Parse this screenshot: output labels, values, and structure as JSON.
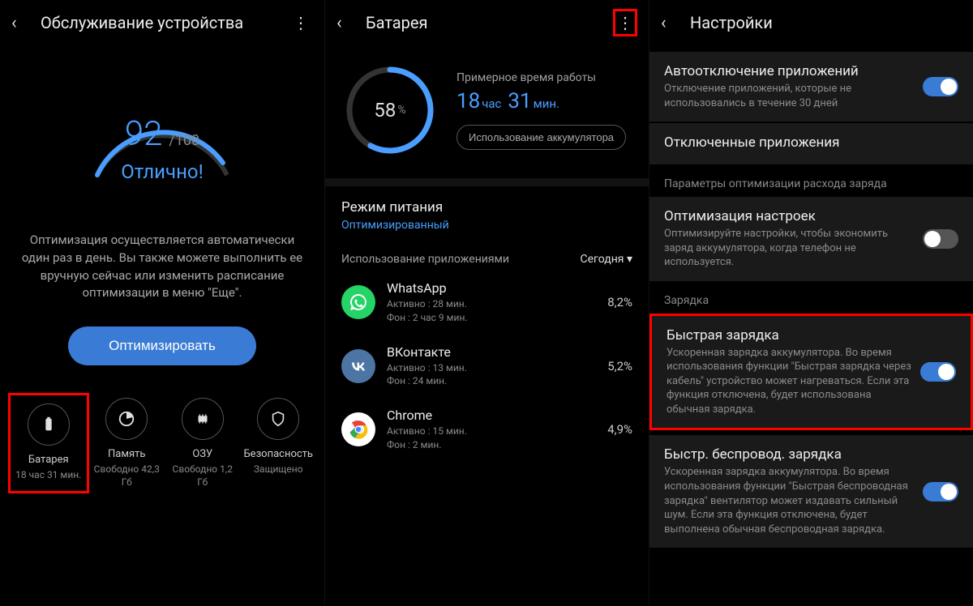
{
  "panel1": {
    "title": "Обслуживание устройства",
    "score": "92",
    "score_max": "/100",
    "status": "Отлично!",
    "desc": "Оптимизация осуществляется автоматически один раз в день. Вы также можете выполнить ее вручную сейчас или изменить расписание оптимизации в меню \"Еще\".",
    "optimize_btn": "Оптимизировать",
    "tiles": [
      {
        "label": "Батарея",
        "sub": "18 час 31 мин."
      },
      {
        "label": "Память",
        "sub": "Свободно 42,3 Гб"
      },
      {
        "label": "ОЗУ",
        "sub": "Свободно 1,2 Гб"
      },
      {
        "label": "Безопасность",
        "sub": "Защищено"
      }
    ]
  },
  "panel2": {
    "title": "Батарея",
    "pct": "58",
    "info_label": "Примерное время работы",
    "time_h": "18",
    "time_h_unit": "час",
    "time_m": "31",
    "time_m_unit": "мин.",
    "usage_btn": "Использование аккумулятора",
    "mode_title": "Режим питания",
    "mode_sub": "Оптимизированный",
    "apps_label": "Использование приложениями",
    "today": "Сегодня",
    "apps": [
      {
        "name": "WhatsApp",
        "active": "Активно : 28 мин.",
        "bg": "Фон : 2 час 9 мин.",
        "pct": "8,2%"
      },
      {
        "name": "ВКонтакте",
        "active": "Активно : 13 мин.",
        "bg": "Фон : 24 мин.",
        "pct": "5,2%"
      },
      {
        "name": "Chrome",
        "active": "Активно : 15 мин.",
        "bg": "Фон : 2 мин.",
        "pct": "4,9%"
      }
    ]
  },
  "panel3": {
    "title": "Настройки",
    "items": [
      {
        "title": "Автоотключение приложений",
        "desc": "Отключение приложений, которые не использовались в течение 30 дней"
      },
      {
        "title": "Отключенные приложения",
        "desc": ""
      }
    ],
    "sec_opt": "Параметры оптимизации расхода заряда",
    "opt_item": {
      "title": "Оптимизация настроек",
      "desc": "Оптимизируйте настройки, чтобы экономить заряд аккумулятора, когда телефон не используется."
    },
    "sec_charge": "Зарядка",
    "fast": {
      "title": "Быстрая зарядка",
      "desc": "Ускоренная зарядка аккумулятора. Во время использования функции \"Быстрая зарядка через кабель\" устройство может нагреваться. Если эта функция отключена, будет использована обычная зарядка."
    },
    "wireless": {
      "title": "Быстр. беспровод. зарядка",
      "desc": "Ускоренная зарядка аккумулятора. Во время использования функции \"Быстрая беспроводная зарядка\" вентилятор может издавать сильный шум. Если эта функция отключена, будет выполнена обычная беспроводная зарядка."
    }
  }
}
